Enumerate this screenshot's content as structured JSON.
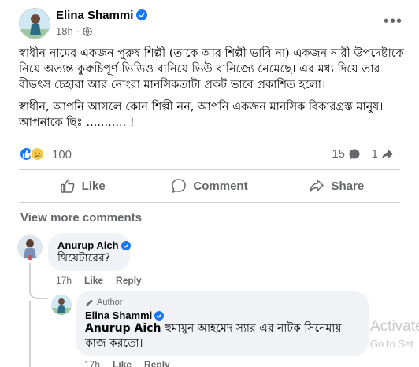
{
  "post": {
    "author": "Elina Shammi",
    "time": "18h",
    "privacy_icon": "globe-icon",
    "more_icon": "ellipsis-icon",
    "paragraphs": [
      "স্বাধীন নামের একজন পুরুষ শিল্পী (তাকে আর শিল্পী ভাবি না) একজন নারী উপদেষ্টাকে নিয়ে অত্যন্ত কুরুচিপূর্ণ ভিডিও বানিয়ে ভিউ বানিজ্যে নেমেছে। এর মধ্য দিয়ে তার বীভৎস চেহারা আর নোংরা মানসিকতাটা প্রকট ভাবে প্রকাশিত হলো।",
      "স্বাধীন, আপনি আসলে কোন শিল্পী নন, আপনি একজন মানসিক বিকারগ্রস্ত মানুষ। আপনাকে ছিঃ ........... !"
    ]
  },
  "stats": {
    "reactions": "100",
    "comments": "15",
    "shares": "1"
  },
  "actions": {
    "like": "Like",
    "comment": "Comment",
    "share": "Share"
  },
  "view_more": "View more comments",
  "comments": [
    {
      "name": "Anurup Aich",
      "text": "থিয়েটারের?",
      "time": "17h",
      "like": "Like",
      "reply": "Reply"
    }
  ],
  "reply": {
    "badge": "Author",
    "name": "Elina Shammi",
    "mention": "Anurup Aich",
    "text": " হুমায়ুন আহমেদ স্যার এর নাটক সিনেমায় কাজ করতো।",
    "time": "17h",
    "like": "Like",
    "reply": "Reply"
  },
  "watermark": {
    "title": "Activate",
    "subtitle": "Go to Set"
  },
  "colors": {
    "accent": "#1877f2",
    "text_secondary": "#65676b",
    "bubble": "#f0f2f5"
  }
}
